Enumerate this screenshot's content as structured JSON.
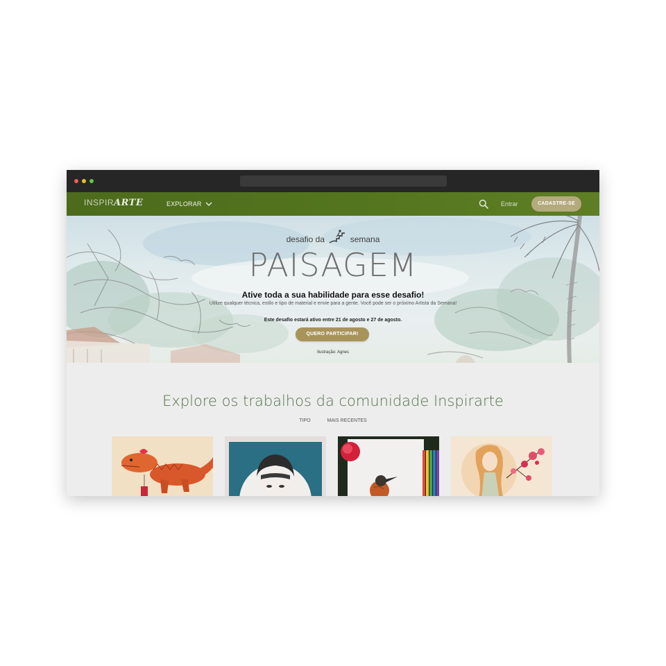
{
  "site": {
    "logo_prefix": "INSPIR",
    "logo_suffix": "ARTE"
  },
  "nav": {
    "explorar": "EXPLORAR",
    "entrar": "Entrar",
    "cadastre": "CADASTRE-SE"
  },
  "hero": {
    "badge_left": "desafio da",
    "badge_right": "semana",
    "title": "PAISAGEM",
    "subtitle": "Ative toda a sua habilidade para esse desafio!",
    "description": "Utilize qualquer técnica, estilo e tipo de material e envie para a gente. Você pode ser o próximo Artista da Semana!",
    "dates": "Este desafio estará ativo entre 21 de agosto e 27 de agosto.",
    "cta": "QUERO PARTICIPAR!",
    "credit": "Ilustração: Agnes"
  },
  "explore": {
    "title": "Explore os trabalhos da comunidade Inspirarte",
    "filters": [
      "TIPO",
      "MAIS RECENTES"
    ]
  },
  "colors": {
    "nav_green": "#55761f",
    "gold_button": "#a8935b",
    "cadastre_button": "#b4aa7d",
    "explore_title": "#53734b"
  },
  "icons": [
    "chevron-down-icon",
    "search-icon",
    "stairs-icon"
  ]
}
